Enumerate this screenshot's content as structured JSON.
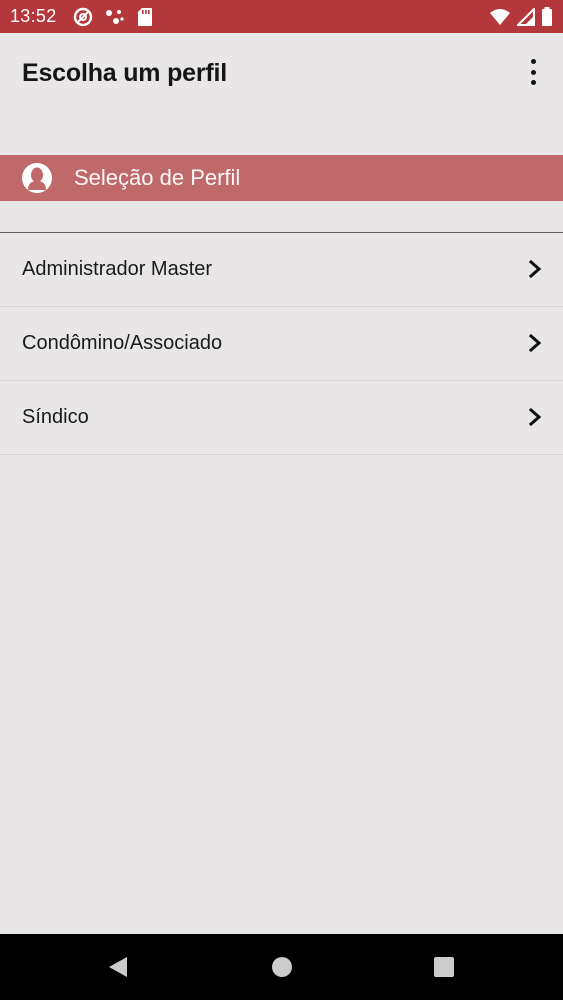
{
  "status_bar": {
    "time": "13:52",
    "background_color": "#b3373b",
    "left_icons": [
      "vpn-key-icon",
      "share-dots-icon",
      "sd-card-icon"
    ],
    "right_icons": [
      "wifi-icon",
      "cellular-signal-icon",
      "battery-icon"
    ]
  },
  "app_bar": {
    "title": "Escolha um perfil",
    "menu_icon": "more-vert-icon"
  },
  "section": {
    "title": "Seleção de Perfil",
    "icon": "person-silhouette-icon",
    "background_color": "#c0696b"
  },
  "profiles": [
    {
      "label": "Administrador Master",
      "icon": "chevron-right-icon"
    },
    {
      "label": "Condômino/Associado",
      "icon": "chevron-right-icon"
    },
    {
      "label": "Síndico",
      "icon": "chevron-right-icon"
    }
  ],
  "nav_bar": {
    "buttons": [
      "back-icon",
      "home-icon",
      "recents-icon"
    ]
  }
}
